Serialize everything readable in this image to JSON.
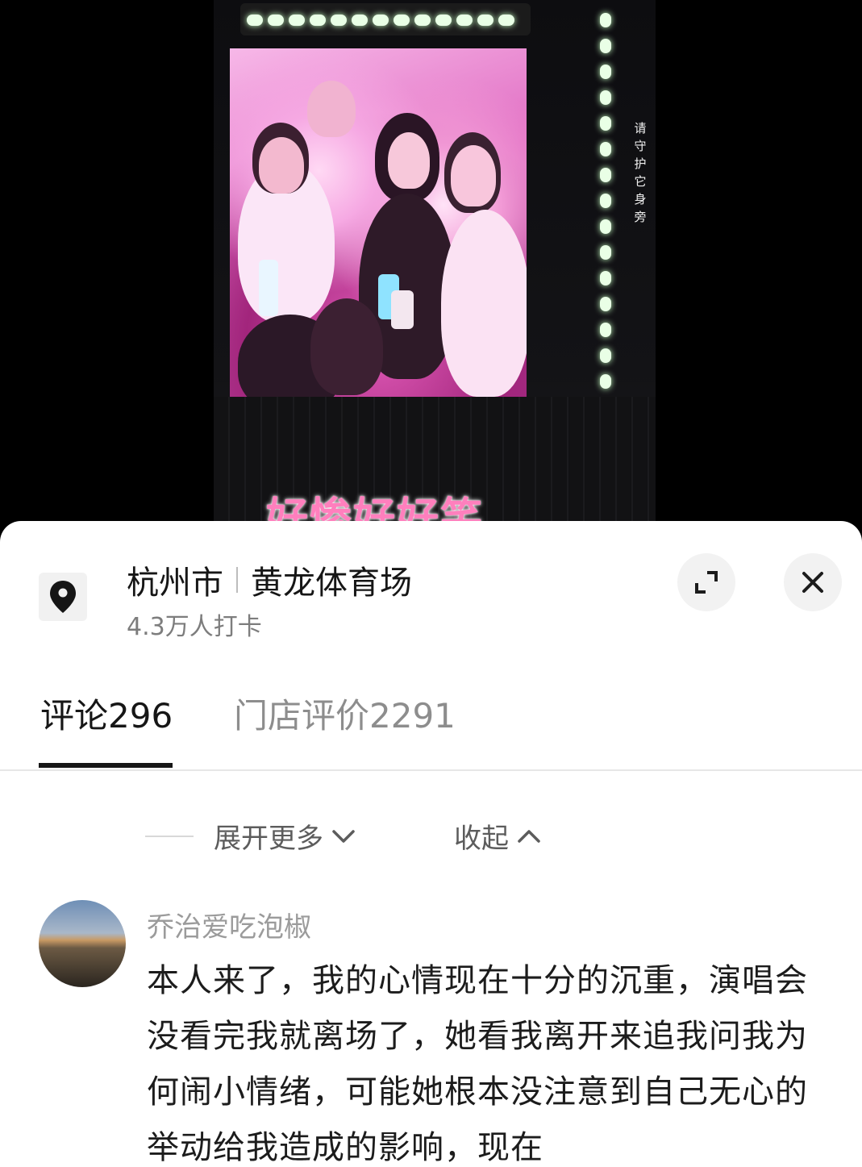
{
  "video": {
    "side_text": "请守护它身旁",
    "caption": "好惨好好笑"
  },
  "location": {
    "icon": "location-pin-icon",
    "city": "杭州市",
    "venue": "黄龙体育场",
    "checkins": "4.3万人打卡"
  },
  "actions": {
    "expand_icon": "expand-icon",
    "close_icon": "close-icon"
  },
  "tabs": [
    {
      "label": "评论",
      "count": "296",
      "active": true
    },
    {
      "label": "门店评价",
      "count": "2291",
      "active": false
    }
  ],
  "thread": {
    "expand_label": "展开更多",
    "collapse_label": "收起"
  },
  "comment": {
    "author": "乔治爱吃泡椒",
    "text": "本人来了，我的心情现在十分的沉重，演唱会没看完我就离场了，她看我离开来追我问我为何闹小情绪，可能她根本没注意到自己无心的举动给我造成的影响，现在"
  }
}
